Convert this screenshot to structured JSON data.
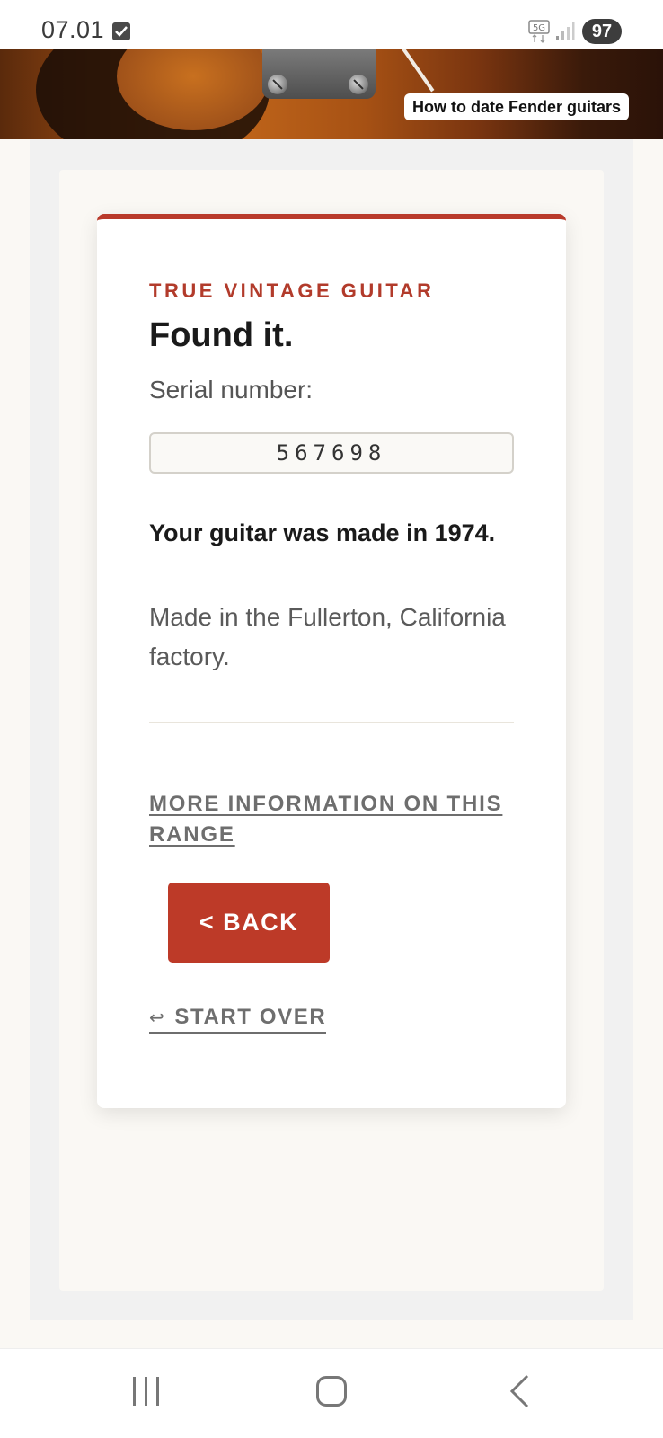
{
  "status_bar": {
    "time": "07.01",
    "network": "5G",
    "battery": "97"
  },
  "banner": {
    "label": "How to date Fender guitars"
  },
  "card": {
    "eyebrow": "TRUE VINTAGE GUITAR",
    "heading": "Found it.",
    "serial_label": "Serial number:",
    "serial_value": "567698",
    "result": "Your guitar was made in 1974.",
    "factory": "Made in the Fullerton, California factory.",
    "more_link": "MORE INFORMATION ON THIS RANGE",
    "back_button": "< BACK",
    "start_over": "START OVER"
  },
  "colors": {
    "accent": "#b93a2b",
    "button": "#bd3a28",
    "page_background": "#faf8f4"
  },
  "icons": {
    "status_check": "checkbox-icon",
    "network": "5g-icon",
    "signal": "signal-icon",
    "start_over": "return-arrow-icon",
    "nav_recent": "recent-apps-icon",
    "nav_home": "home-icon",
    "nav_back": "back-icon"
  }
}
